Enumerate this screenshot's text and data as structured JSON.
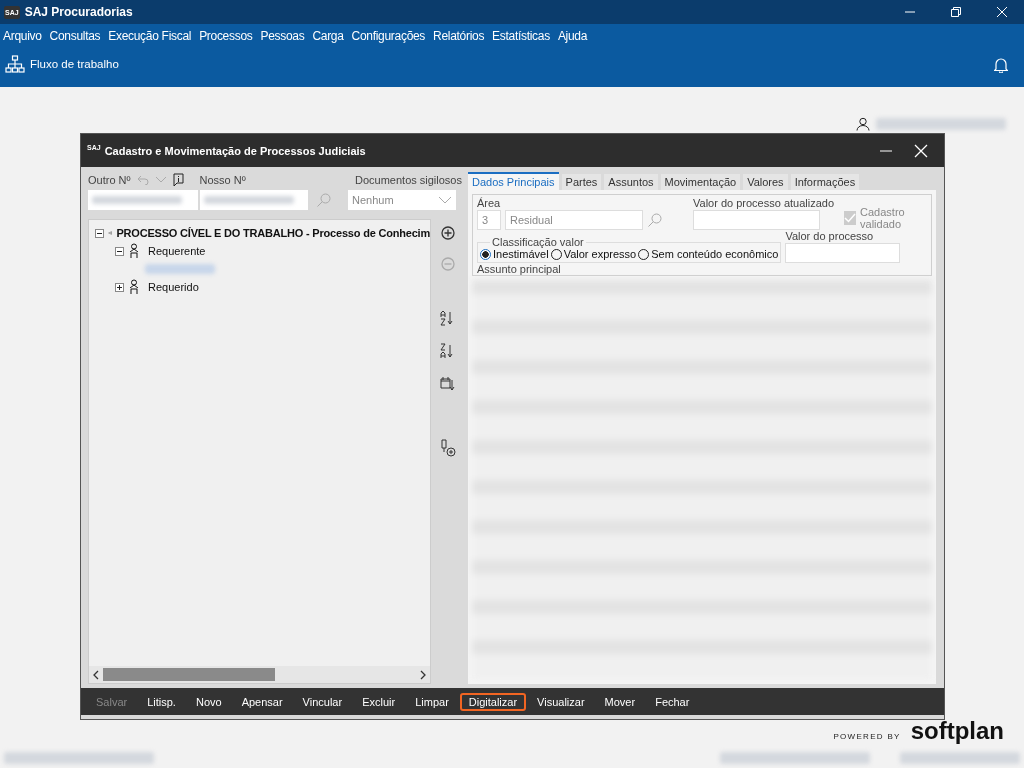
{
  "app": {
    "logo": "SAJ",
    "title": "SAJ Procuradorias"
  },
  "menu": [
    "Arquivo",
    "Consultas",
    "Execução Fiscal",
    "Processos",
    "Pessoas",
    "Carga",
    "Configurações",
    "Relatórios",
    "Estatísticas",
    "Ajuda"
  ],
  "toolbar": {
    "label": "Fluxo de trabalho"
  },
  "dialog": {
    "logo": "SAJ",
    "title": "Cadastro e Movimentação de Processos Judiciais",
    "outro_label": "Outro Nº",
    "nosso_label": "Nosso Nº",
    "docs_label": "Documentos sigilosos",
    "docs_value": "Nenhum",
    "tree": [
      {
        "label": "PROCESSO CÍVEL E DO TRABALHO - Processo de Conhecim",
        "expanded": true,
        "children": [
          {
            "label": "Requerente",
            "expanded": true
          },
          {
            "label": "Requerido",
            "expanded": false
          }
        ]
      }
    ],
    "tabs": [
      {
        "label": "Dados Principais",
        "selected": true
      },
      {
        "label": "Partes",
        "selected": false
      },
      {
        "label": "Assuntos",
        "selected": false
      },
      {
        "label": "Movimentação",
        "selected": false
      },
      {
        "label": "Valores",
        "selected": false
      },
      {
        "label": "Informações",
        "selected": false
      }
    ],
    "area": {
      "label": "Área",
      "code": "3",
      "name": "Residual"
    },
    "valor_atualizado_label": "Valor do processo atualizado",
    "cadastro_validado": {
      "label": "Cadastro validado",
      "checked": true,
      "disabled": true
    },
    "classificacao": {
      "label": "Classificação valor",
      "options": [
        {
          "label": "Inestimável",
          "selected": true
        },
        {
          "label": "Valor expresso",
          "selected": false
        },
        {
          "label": "Sem conteúdo econômico",
          "selected": false
        }
      ]
    },
    "valor_processo_label": "Valor do processo",
    "assunto_label": "Assunto principal",
    "buttons": [
      {
        "label": "Salvar",
        "disabled": true,
        "highlighted": false
      },
      {
        "label": "Litisp.",
        "disabled": false,
        "highlighted": false
      },
      {
        "label": "Novo",
        "disabled": false,
        "highlighted": false
      },
      {
        "label": "Apensar",
        "disabled": false,
        "highlighted": false
      },
      {
        "label": "Vincular",
        "disabled": false,
        "highlighted": false
      },
      {
        "label": "Excluir",
        "disabled": false,
        "highlighted": false
      },
      {
        "label": "Limpar",
        "disabled": false,
        "highlighted": false
      },
      {
        "label": "Digitalizar",
        "disabled": false,
        "highlighted": true
      },
      {
        "label": "Visualizar",
        "disabled": false,
        "highlighted": false
      },
      {
        "label": "Mover",
        "disabled": false,
        "highlighted": false
      },
      {
        "label": "Fechar",
        "disabled": false,
        "highlighted": false
      }
    ]
  },
  "footer": {
    "powered": "POWERED BY",
    "brand": "softplan"
  }
}
